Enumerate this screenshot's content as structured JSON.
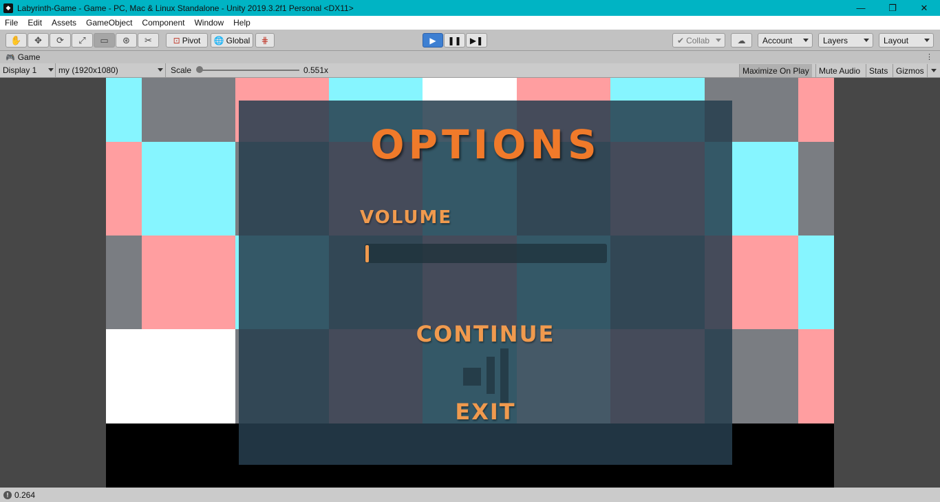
{
  "window": {
    "title": "Labyrinth-Game - Game - PC, Mac & Linux Standalone - Unity 2019.3.2f1 Personal <DX11>",
    "controls": [
      "—",
      "❐",
      "✕"
    ]
  },
  "menu": [
    "File",
    "Edit",
    "Assets",
    "GameObject",
    "Component",
    "Window",
    "Help"
  ],
  "toolbar": {
    "pivot_label": "Pivot",
    "global_label": "Global",
    "collab_label": "Collab",
    "account_label": "Account",
    "layers_label": "Layers",
    "layout_label": "Layout"
  },
  "game_tab": {
    "label": "Game"
  },
  "game_bar": {
    "display": "Display 1",
    "resolution": "my (1920x1080)",
    "scale_label": "Scale",
    "scale_value": "0.551x",
    "scale_fraction": 0.0,
    "maximize_label": "Maximize On Play",
    "mute_label": "Mute Audio",
    "stats_label": "Stats",
    "gizmos_label": "Gizmos"
  },
  "game": {
    "options_title": "OPTIONS",
    "volume_label": "VOLUME",
    "volume_level": 0.0,
    "continue_label": "CONTINUE",
    "exit_label": "EXIT"
  },
  "colors": {
    "cyan": "#86f5ff",
    "pink": "#ff9ea0",
    "gray": "#7a7d82",
    "white": "#ffffff",
    "accent_orange": "#f07a2a"
  },
  "status": {
    "value": "0.264"
  }
}
